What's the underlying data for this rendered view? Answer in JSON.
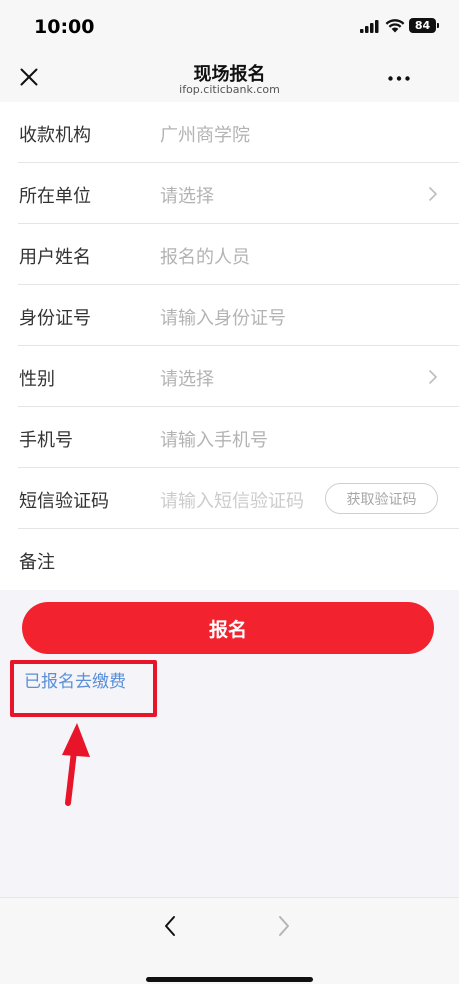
{
  "status_bar": {
    "time": "10:00",
    "battery": "84"
  },
  "nav": {
    "title": "现场报名",
    "subtitle": "ifop.citicbank.com"
  },
  "form": {
    "rows": [
      {
        "label": "收款机构",
        "value": "广州商学院"
      },
      {
        "label": "所在单位",
        "value": "请选择"
      },
      {
        "label": "用户姓名",
        "value": "报名的人员"
      },
      {
        "label": "身份证号",
        "value": "请输入身份证号"
      },
      {
        "label": "性别",
        "value": "请选择"
      },
      {
        "label": "手机号",
        "value": "请输入手机号"
      },
      {
        "label": "短信验证码",
        "value": "请输入短信验证码"
      },
      {
        "label": "备注",
        "value": ""
      }
    ],
    "code_button": "获取验证码"
  },
  "actions": {
    "submit_label": "报名",
    "paid_link": "已报名去缴费"
  },
  "colors": {
    "primary_red": "#f3222f",
    "link_blue": "#5a8fd8",
    "annotation_red": "#e8152a"
  }
}
